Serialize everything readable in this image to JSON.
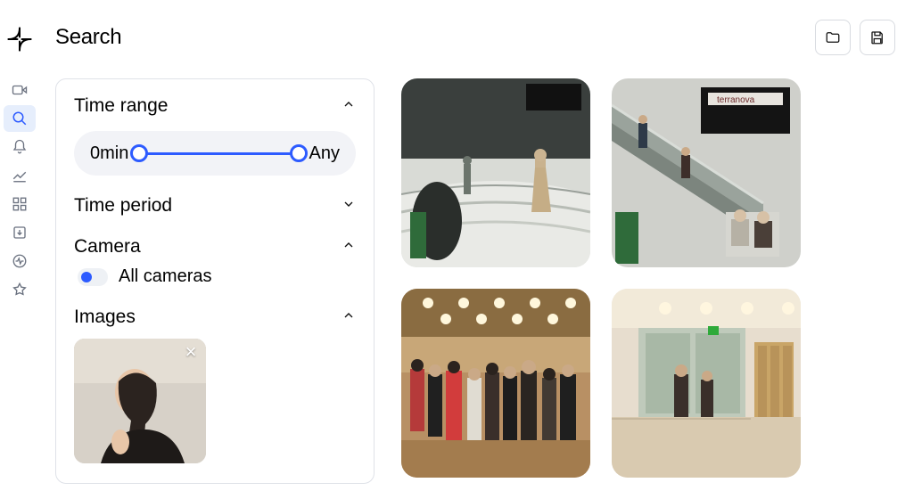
{
  "header": {
    "title": "Search"
  },
  "sidebar": {
    "items": [
      {
        "name": "video-icon",
        "active": false
      },
      {
        "name": "search-icon",
        "active": true
      },
      {
        "name": "bell-icon",
        "active": false
      },
      {
        "name": "chart-icon",
        "active": false
      },
      {
        "name": "grid-icon",
        "active": false
      },
      {
        "name": "download-icon",
        "active": false
      },
      {
        "name": "health-icon",
        "active": false
      },
      {
        "name": "star-icon",
        "active": false
      }
    ]
  },
  "panel": {
    "time_range": {
      "title": "Time range",
      "expanded": true,
      "min_label": "0min",
      "max_label": "Any"
    },
    "time_period": {
      "title": "Time period",
      "expanded": false
    },
    "camera": {
      "title": "Camera",
      "expanded": true,
      "selection_label": "All cameras"
    },
    "images": {
      "title": "Images",
      "expanded": true,
      "query_thumb_alt": "reference-person"
    }
  },
  "results": [
    {
      "name": "result-mall-atrium"
    },
    {
      "name": "result-escalator"
    },
    {
      "name": "result-store-crowd"
    },
    {
      "name": "result-lobby-entrance"
    }
  ]
}
